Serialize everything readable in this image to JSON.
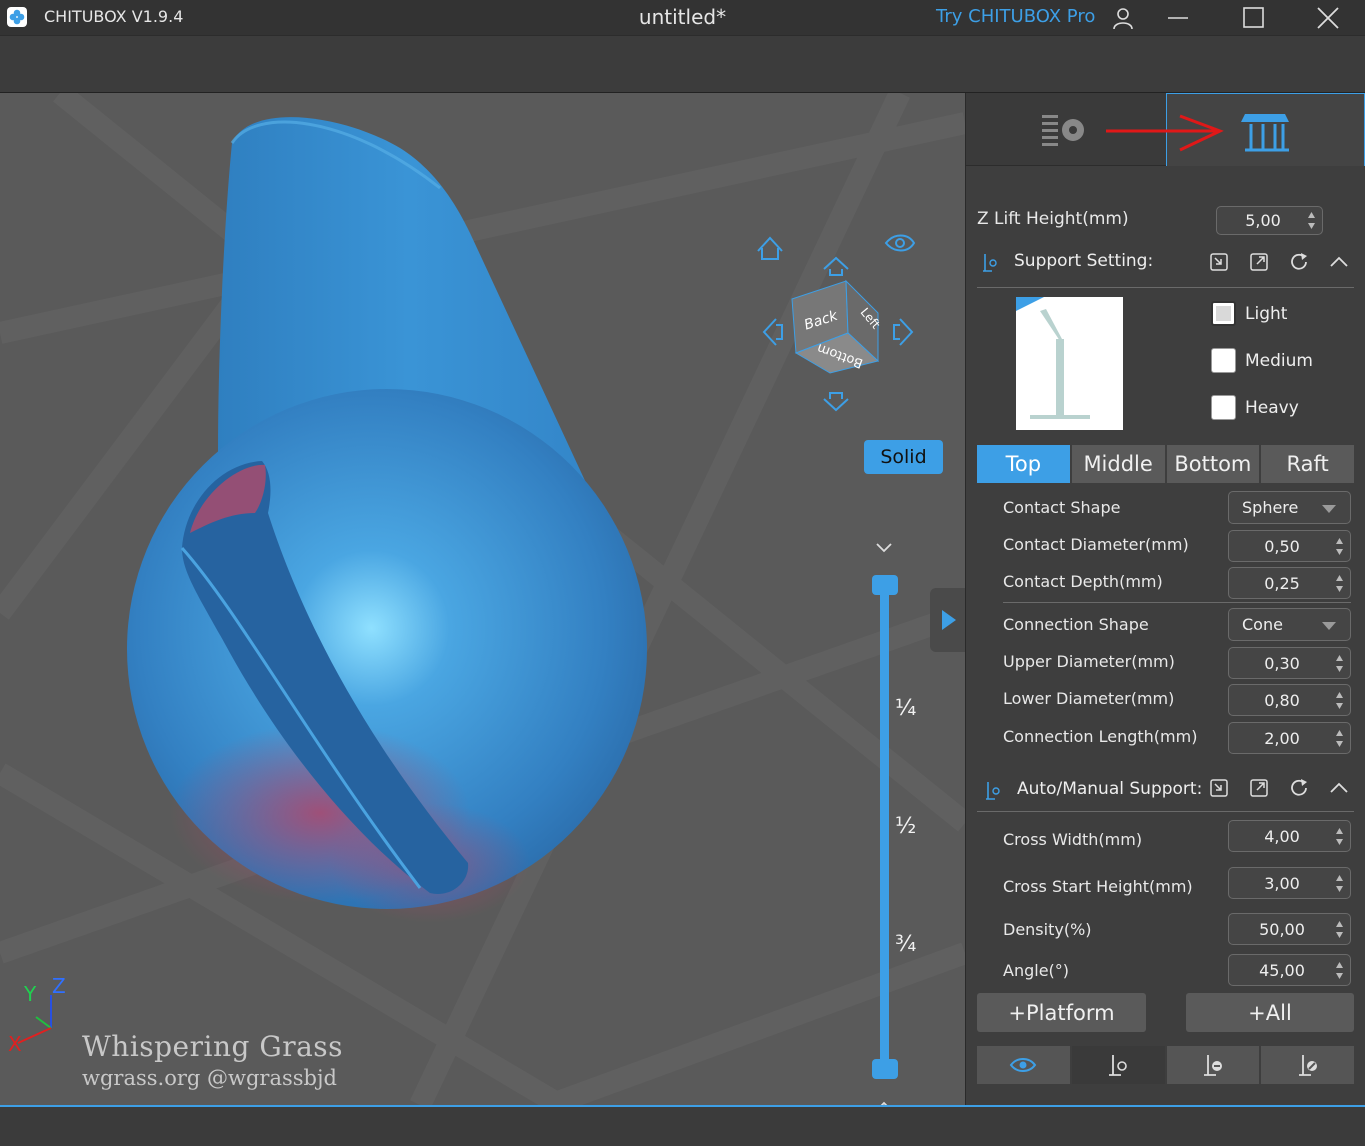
{
  "titlebar": {
    "app_name": "CHITUBOX V1.9.4",
    "doc_title": "untitled*",
    "try_pro": "Try CHITUBOX Pro"
  },
  "viewport": {
    "cube_faces": {
      "back": "Back",
      "left": "Left",
      "bottom": "Bottom"
    },
    "solid_label": "Solid",
    "slider_labels": [
      "¼",
      "½",
      "¾"
    ],
    "watermark_line1": "Whispering Grass",
    "watermark_line2": "wgrass.org @wgrassbjd",
    "axis": {
      "x": "X",
      "y": "Y",
      "z": "Z"
    }
  },
  "panel": {
    "zlift_label": "Z Lift Height(mm)",
    "zlift_value": "5,00",
    "support_setting_label": "Support Setting:",
    "density_options": [
      {
        "label": "Light",
        "checked": true
      },
      {
        "label": "Medium",
        "checked": false
      },
      {
        "label": "Heavy",
        "checked": false
      }
    ],
    "tabs": [
      "Top",
      "Middle",
      "Bottom",
      "Raft"
    ],
    "active_tab": "Top",
    "contact_shape_label": "Contact Shape",
    "contact_shape_value": "Sphere",
    "contact_diameter_label": "Contact Diameter(mm)",
    "contact_diameter_value": "0,50",
    "contact_depth_label": "Contact Depth(mm)",
    "contact_depth_value": "0,25",
    "connection_shape_label": "Connection Shape",
    "connection_shape_value": "Cone",
    "upper_diameter_label": "Upper Diameter(mm)",
    "upper_diameter_value": "0,30",
    "lower_diameter_label": "Lower Diameter(mm)",
    "lower_diameter_value": "0,80",
    "connection_length_label": "Connection Length(mm)",
    "connection_length_value": "2,00",
    "auto_manual_label": "Auto/Manual Support:",
    "cross_width_label": "Cross Width(mm)",
    "cross_width_value": "4,00",
    "cross_start_label": "Cross Start Height(mm)",
    "cross_start_value": "3,00",
    "density_label": "Density(%)",
    "density_value": "50,00",
    "angle_label": "Angle(°)",
    "angle_value": "45,00",
    "platform_button": "+Platform",
    "all_button": "+All"
  },
  "colors": {
    "accent": "#3d9fe6",
    "model": "#3a8fd0",
    "overhang": "#b04a6a",
    "annotation_arrow": "#e01818"
  }
}
